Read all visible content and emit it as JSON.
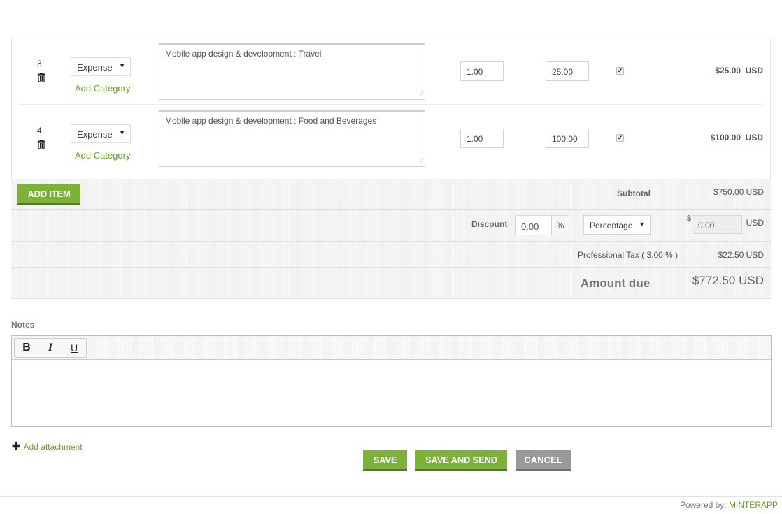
{
  "items": [
    {
      "number": "3",
      "type": "Expense",
      "add_category": "Add Category",
      "description": "Mobile app design & development  : Travel",
      "quantity": "1.00",
      "rate": "25.00",
      "taxable": true,
      "amount": "$25.00",
      "currency": "USD"
    },
    {
      "number": "4",
      "type": "Expense",
      "add_category": "Add Category",
      "description": "Mobile app design & development  : Food and Beverages",
      "quantity": "1.00",
      "rate": "100.00",
      "taxable": true,
      "amount": "$100.00",
      "currency": "USD"
    }
  ],
  "add_item_label": "ADD ITEM",
  "totals": {
    "subtotal_label": "Subtotal",
    "subtotal_value": "$750.00  USD",
    "discount_label": "Discount",
    "discount_value": "0.00",
    "discount_unit": "%",
    "discount_type": "Percentage",
    "discount_currency_symbol": "$",
    "discount_amount": "0.00",
    "discount_currency": "USD",
    "tax_label": "Professional Tax ( 3.00 % )",
    "tax_value": "$22.50  USD",
    "amount_due_label": "Amount due",
    "amount_due_value": "$772.50 USD"
  },
  "notes": {
    "label": "Notes",
    "toolbar": {
      "bold": "B",
      "italic": "I",
      "underline": "U"
    },
    "content": ""
  },
  "add_attachment": "Add attachment",
  "actions": {
    "save": "SAVE",
    "save_and_send": "SAVE AND SEND",
    "cancel": "CANCEL"
  },
  "footer": {
    "powered_by": "Powered by: ",
    "brand": "MINTERAPP"
  },
  "colors": {
    "accent_green": "#7cb23a",
    "link_green": "#6a9e2b",
    "cancel_grey": "#9a9a9a"
  }
}
